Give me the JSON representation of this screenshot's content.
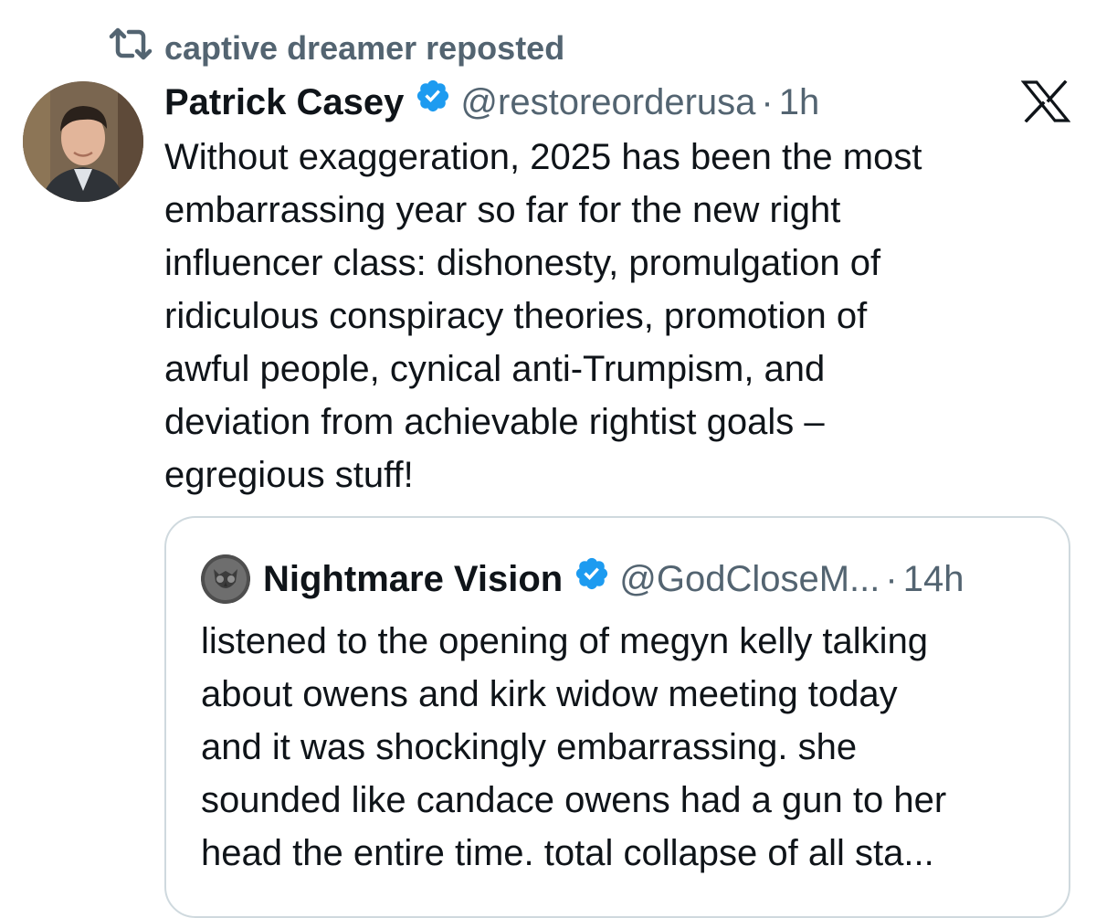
{
  "repost": {
    "icon": "repost-icon",
    "label": "captive dreamer reposted"
  },
  "tweet": {
    "author_name": "Patrick Casey",
    "verified_icon": "verified-badge-icon",
    "handle": "@restoreorderusa",
    "separator": "·",
    "time": "1h",
    "text": "Without exaggeration, 2025 has been the most\nembarrassing year so far for the new right\ninfluencer class: dishonesty, promulgation of\nridiculous conspiracy theories, promotion of\nawful people, cynical anti-Trumpism, and\ndeviation from achievable rightist goals –\negregious stuff!",
    "platform_icon": "x-logo-icon"
  },
  "quote": {
    "author_name": "Nightmare Vision",
    "verified_icon": "verified-badge-icon",
    "handle": "@GodCloseM...",
    "separator": "·",
    "time": "14h",
    "text": "listened to the opening of megyn kelly talking\nabout owens and kirk widow meeting today\nand it was shockingly embarrassing. she\nsounded like candace owens had a gun to her\nhead the entire time. total collapse of all sta..."
  },
  "colors": {
    "text_primary": "#0f1419",
    "text_secondary": "#536471",
    "verified_blue": "#1d9bf0",
    "card_border": "#cfd9de"
  }
}
